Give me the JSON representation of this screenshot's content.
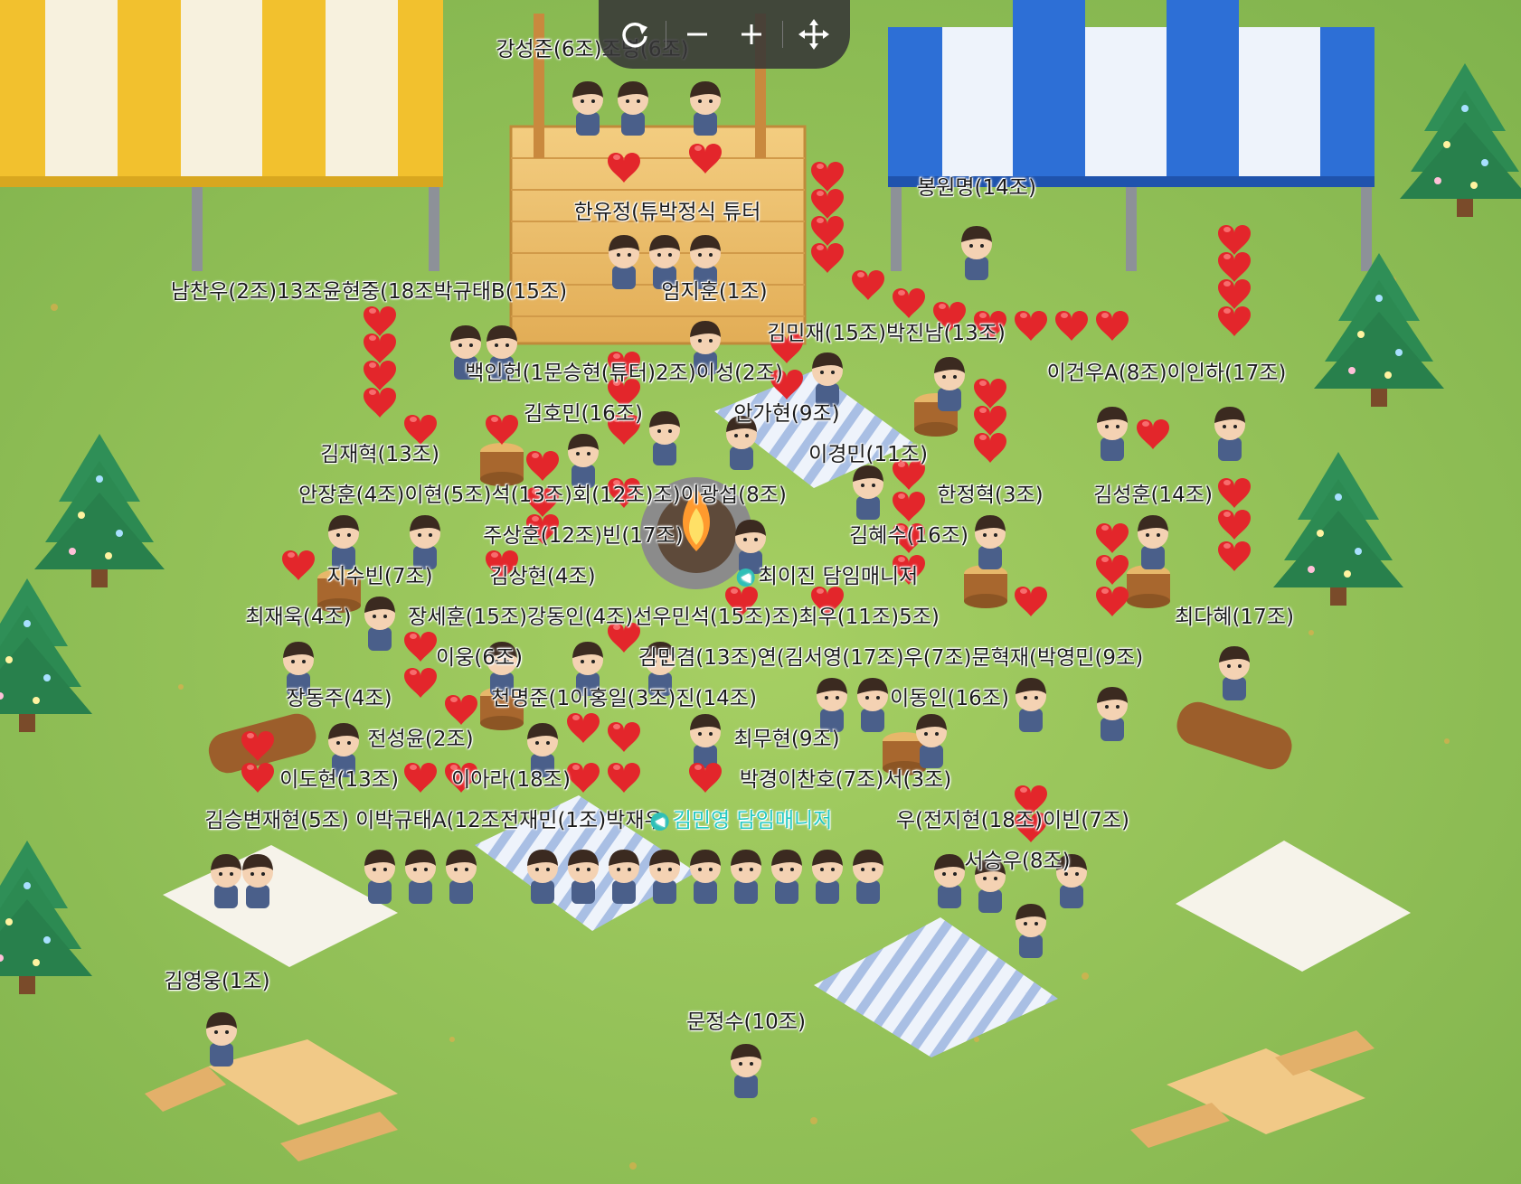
{
  "toolbar": {
    "refresh_label": "refresh-icon",
    "zoom_out_label": "zoom-out-icon",
    "zoom_in_label": "zoom-in-icon",
    "move_label": "move-icon"
  },
  "colors": {
    "grass": "#8fc15a",
    "tent_yellow": "#f2c12e",
    "tent_blue": "#2d6fd6",
    "heart": "#e3262b",
    "manager_name": "#23c9c1"
  },
  "labels": [
    "강성준(6조)조명(6조)",
    "봉원명(14조)",
    "한유정(튜박정식 튜터",
    "남찬우(2조)13조윤현중(18조박규태B(15조)",
    "엄지훈(1조)",
    "김민재(15조)박진남(13조)",
    "백인헌(1문승현(튜터)2조)이성(2조)",
    "이건우A(8조)이인하(17조)",
    "김호민(16조)",
    "안가현(9조)",
    "김재혁(13조)",
    "이경민(11조)",
    "안장훈(4조)이현(5조)석(13조)회(12조)조)이광섭(8조)",
    "한정혁(3조)",
    "김성훈(14조)",
    "주상훈(12조)빈(17조)",
    "김혜수(16조)",
    "지수빈(7조)",
    "김상현(4조)",
    "최이진 담임매니저",
    "최재욱(4조)",
    "장세훈(15조)강동인(4조)선우민석(15조)조)최우(11조)5조)",
    "최다혜(17조)",
    "이웅(6조)",
    "김민겸(13조)연(김서영(17조)우(7조)문혁재(박영민(9조)",
    "장동주(4조)",
    "천명준(1이홍일(3조)진(14조)",
    "이동인(16조)",
    "전성윤(2조)",
    "최무현(9조)",
    "이도현(13조)",
    "이아라(18조)",
    "박경이찬호(7조)서(3조)",
    "김승변재현(5조) 이박규태A(12조전재민(1조)박재우",
    "김민영 담임매니저",
    "우(전지현(18조)이빈(7조)",
    "서승우(8조)",
    "김영웅(1조)",
    "문정수(10조)"
  ]
}
